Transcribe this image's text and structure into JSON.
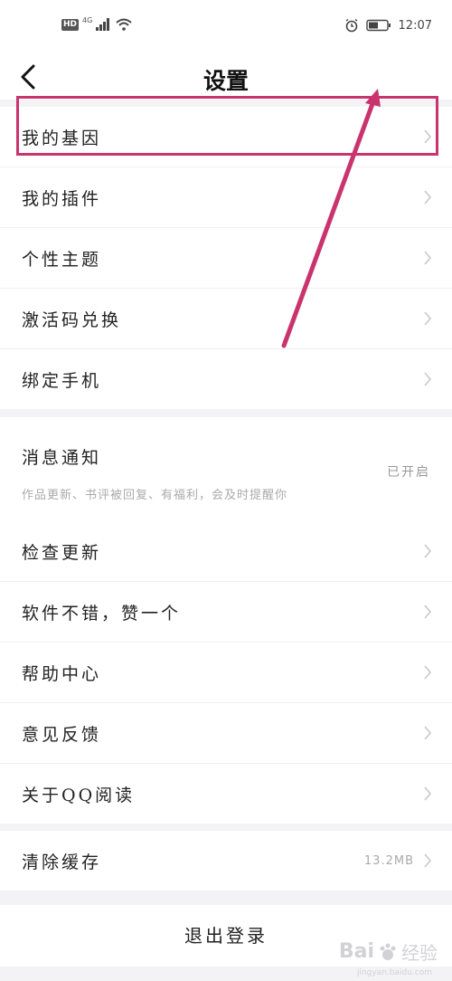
{
  "status_bar": {
    "hd": "HD",
    "network": "4G",
    "time": "12:07"
  },
  "header": {
    "title": "设置"
  },
  "group1": [
    {
      "label": "我的基因"
    },
    {
      "label": "我的插件"
    },
    {
      "label": "个性主题"
    },
    {
      "label": "激活码兑换"
    },
    {
      "label": "绑定手机"
    }
  ],
  "notification": {
    "title": "消息通知",
    "subtitle": "作品更新、书评被回复、有福利，会及时提醒你",
    "status": "已开启"
  },
  "group3": [
    {
      "label": "检查更新"
    },
    {
      "label": "软件不错，赞一个"
    },
    {
      "label": "帮助中心"
    },
    {
      "label": "意见反馈"
    },
    {
      "label": "关于QQ阅读"
    }
  ],
  "cache": {
    "label": "清除缓存",
    "value": "13.2MB"
  },
  "logout": {
    "label": "退出登录"
  },
  "watermark": {
    "text": "Bai",
    "cn": "经验",
    "url": "jingyan.baidu.com"
  },
  "colors": {
    "annotation": "#c9346e",
    "background": "#f3f3f5"
  }
}
